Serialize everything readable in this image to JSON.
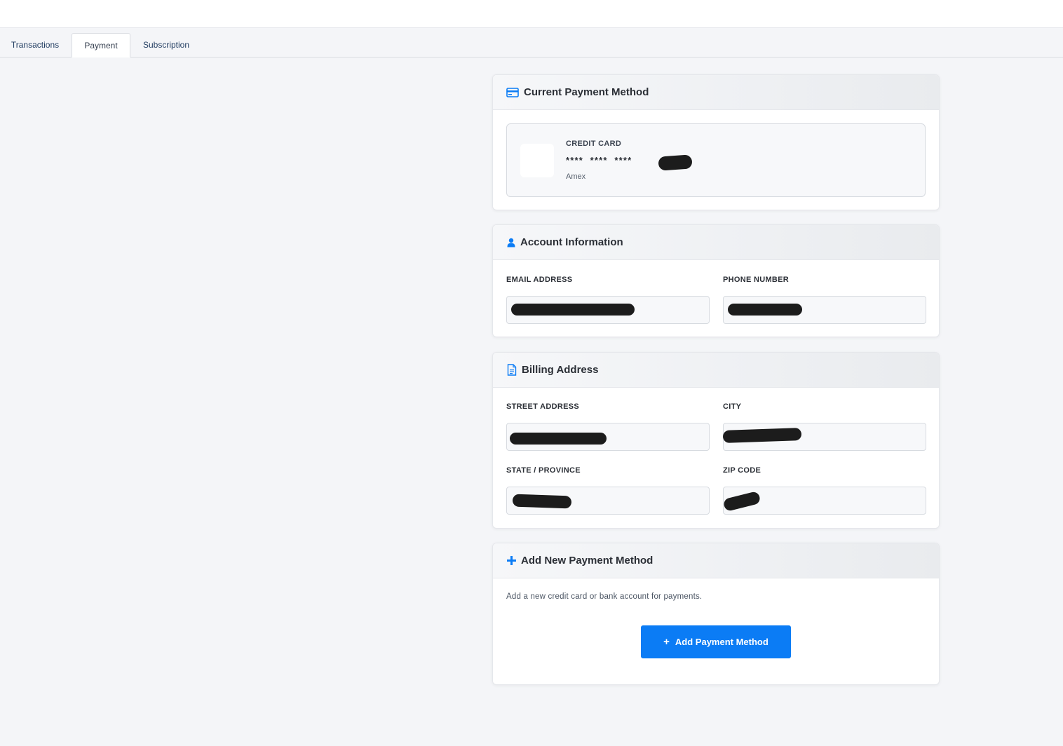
{
  "tabs": [
    {
      "label": "Transactions"
    },
    {
      "label": "Payment"
    },
    {
      "label": "Subscription"
    }
  ],
  "current_payment": {
    "title": "Current Payment Method",
    "icon": "credit-card-icon",
    "type": "CREDIT CARD",
    "number": "****  ****  ****",
    "brand": "Amex"
  },
  "account": {
    "title": "Account Information",
    "icon": "user-icon",
    "email_label": "EMAIL ADDRESS",
    "phone_label": "PHONE NUMBER"
  },
  "billing": {
    "title": "Billing Address",
    "icon": "document-icon",
    "street_label": "STREET ADDRESS",
    "city_label": "CITY",
    "state_label": "STATE / PROVINCE",
    "zip_label": "ZIP CODE"
  },
  "add_payment": {
    "title": "Add New Payment Method",
    "icon": "plus-icon",
    "description": "Add a new credit card or bank account for payments.",
    "button_label": "Add Payment Method"
  },
  "colors": {
    "accent": "#0b7cf5",
    "background": "#f4f5f8",
    "redaction": "#1c1c1c"
  }
}
